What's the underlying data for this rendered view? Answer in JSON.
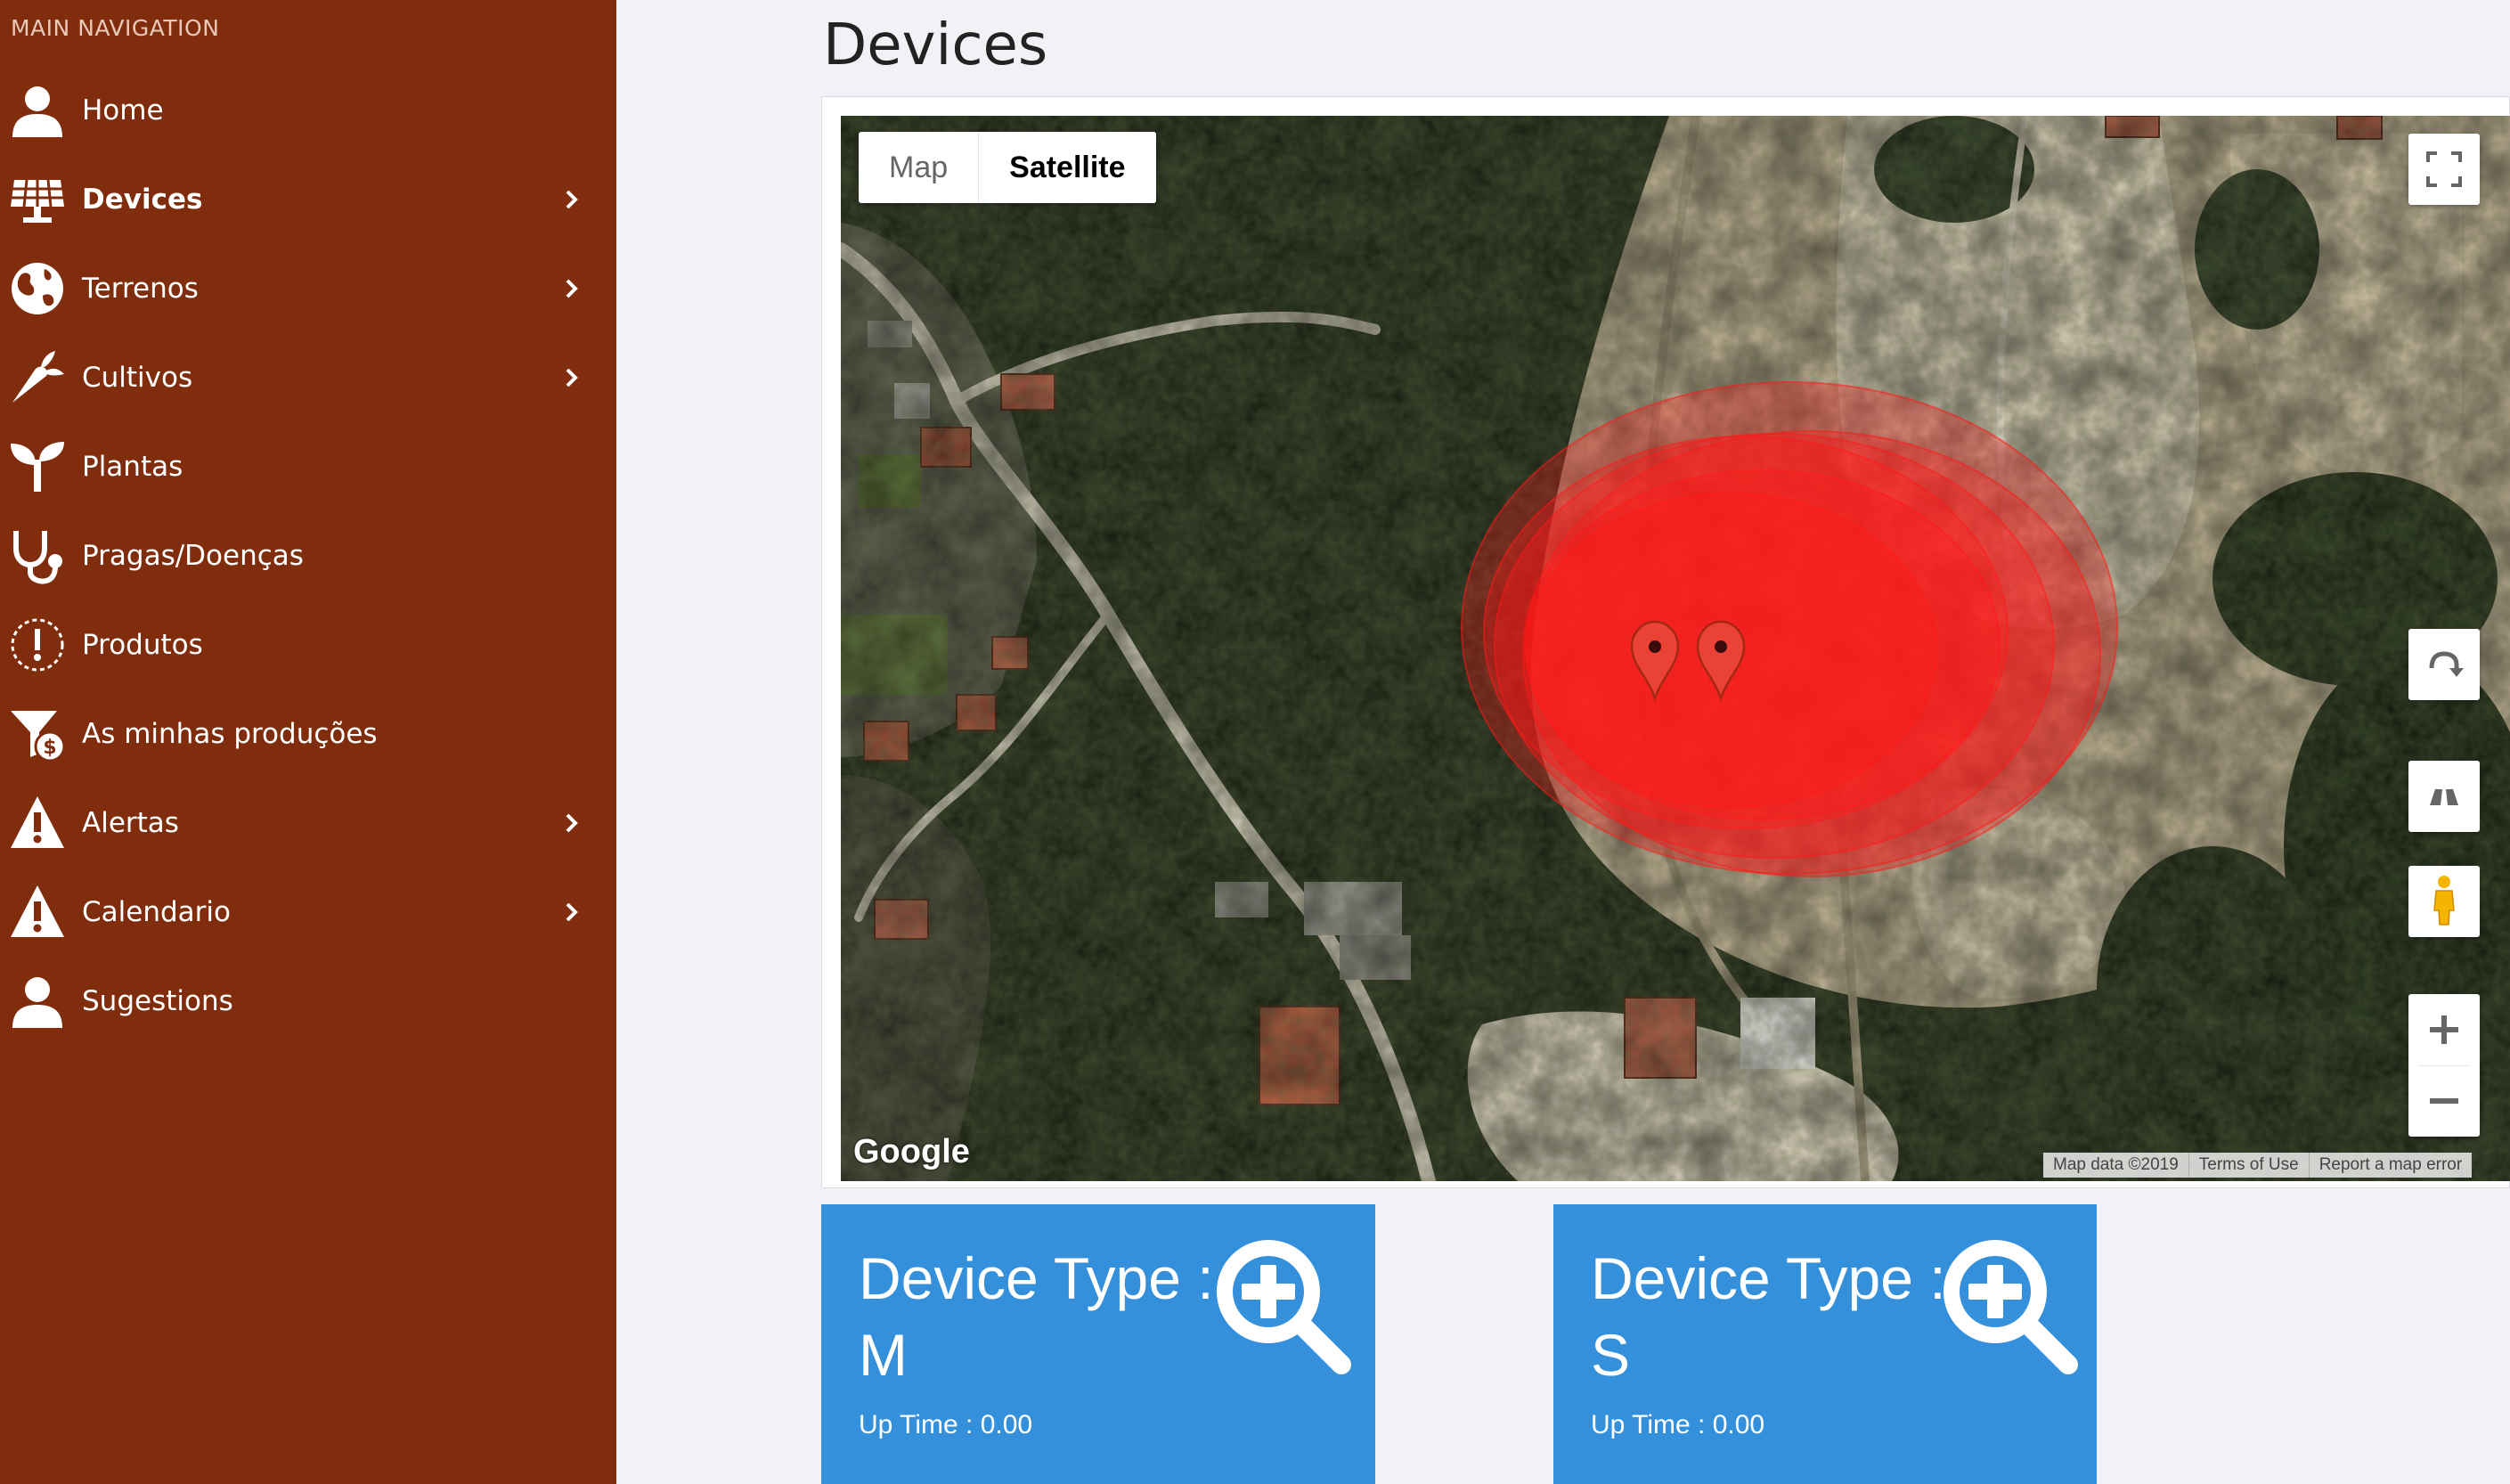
{
  "sidebar": {
    "header": "MAIN NAVIGATION",
    "background": "#7f2d0c",
    "items": [
      {
        "label": "Home",
        "icon": "user-icon",
        "has_submenu": false
      },
      {
        "label": "Devices",
        "icon": "solar-panel-icon",
        "has_submenu": true,
        "active": true
      },
      {
        "label": "Terrenos",
        "icon": "globe-icon",
        "has_submenu": true
      },
      {
        "label": "Cultivos",
        "icon": "carrot-icon",
        "has_submenu": true
      },
      {
        "label": "Plantas",
        "icon": "seedling-icon",
        "has_submenu": false
      },
      {
        "label": "Pragas/Doenças",
        "icon": "stethoscope-icon",
        "has_submenu": false
      },
      {
        "label": "Produtos",
        "icon": "alert-circle-icon",
        "has_submenu": false
      },
      {
        "label": "As minhas produções",
        "icon": "funnel-dollar-icon",
        "has_submenu": false
      },
      {
        "label": "Alertas",
        "icon": "warning-icon",
        "has_submenu": true
      },
      {
        "label": "Calendario",
        "icon": "warning-icon",
        "has_submenu": true
      },
      {
        "label": "Sugestions",
        "icon": "user-icon",
        "has_submenu": false
      }
    ]
  },
  "page": {
    "title": "Devices"
  },
  "map": {
    "type_buttons": [
      "Map",
      "Satellite"
    ],
    "selected_type": "Satellite",
    "logo": "Google",
    "footer": [
      "Map data ©2019",
      "Terms of Use",
      "Report a map error"
    ],
    "controls": [
      "fullscreen-icon",
      "rotate-icon",
      "tilt-icon",
      "pegman-icon",
      "zoom-in-icon",
      "zoom-out-icon"
    ],
    "markers": 2,
    "circle_color": "#ff1a1a"
  },
  "devices": [
    {
      "title": "Device Type : M",
      "uptime": "Up Time : 0.00",
      "icon": "zoom-in-magnifier-icon"
    },
    {
      "title": "Device Type : S",
      "uptime": "Up Time : 0.00",
      "icon": "zoom-in-magnifier-icon"
    }
  ],
  "colors": {
    "card": "#3590db",
    "page_bg": "#f1f2f6"
  }
}
